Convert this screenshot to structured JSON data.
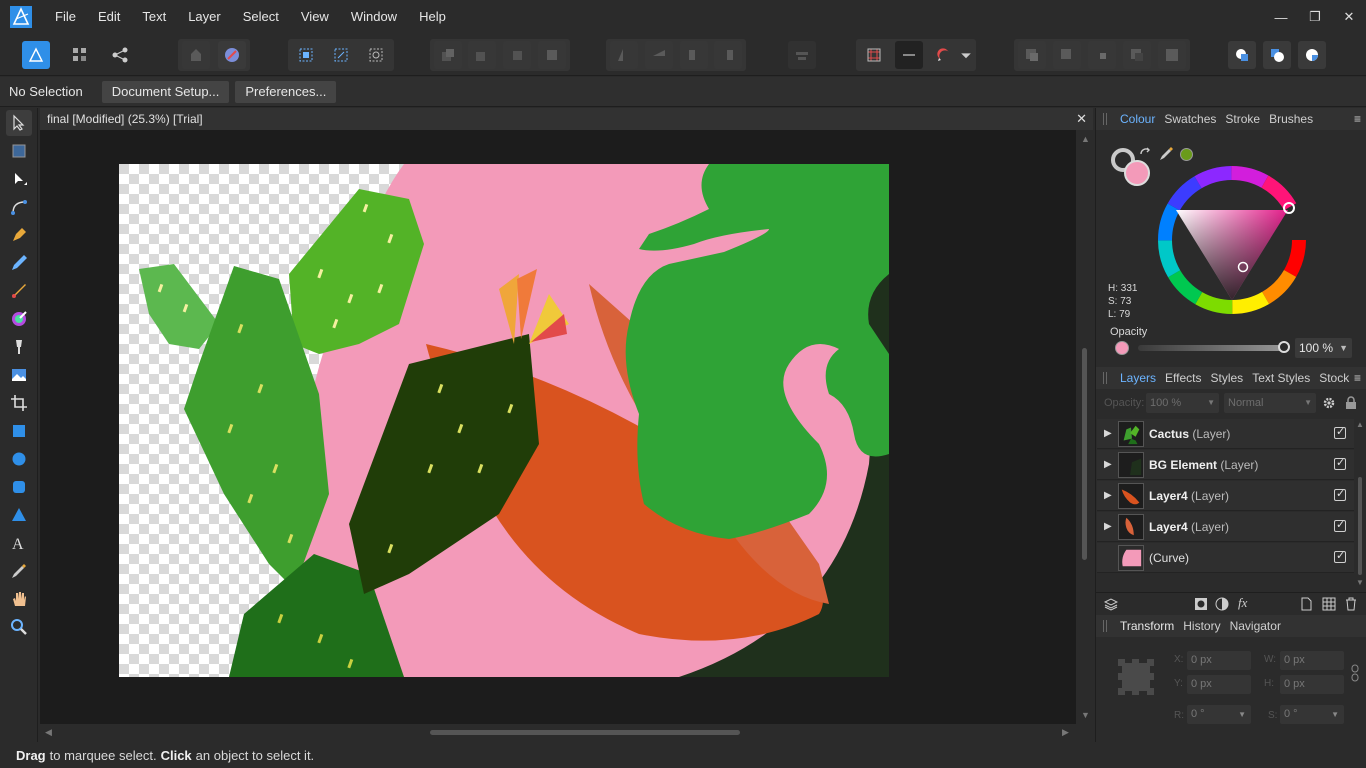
{
  "menubar": {
    "items": [
      "File",
      "Edit",
      "Text",
      "Layer",
      "Select",
      "View",
      "Window",
      "Help"
    ],
    "window_controls": [
      "minimize",
      "restore",
      "close"
    ]
  },
  "context": {
    "selection_label": "No Selection",
    "document_setup": "Document Setup...",
    "preferences": "Preferences..."
  },
  "document": {
    "tab_title": "final [Modified] (25.3%) [Trial]"
  },
  "colour_panel": {
    "tabs": [
      "Colour",
      "Swatches",
      "Stroke",
      "Brushes"
    ],
    "active_tab": "Colour",
    "h": "H: 331",
    "s": "S: 73",
    "l": "L: 79",
    "opacity_label": "Opacity",
    "opacity_value": "100 %",
    "current_colour": "#f39ab9"
  },
  "layers_panel": {
    "tabs": [
      "Layers",
      "Effects",
      "Styles",
      "Text Styles",
      "Stock"
    ],
    "active_tab": "Layers",
    "opacity_label": "Opacity:",
    "opacity_value": "100 %",
    "blend_mode": "Normal",
    "layers": [
      {
        "name": "Cactus",
        "type": "(Layer)",
        "expandable": true,
        "visible": true
      },
      {
        "name": "BG Element",
        "type": "(Layer)",
        "expandable": true,
        "visible": true
      },
      {
        "name": "Layer4",
        "type": "(Layer)",
        "expandable": true,
        "visible": true
      },
      {
        "name": "Layer4",
        "type": "(Layer)",
        "expandable": true,
        "visible": true
      },
      {
        "name": "",
        "type": "(Curve)",
        "expandable": false,
        "visible": true
      }
    ]
  },
  "transform_panel": {
    "tabs": [
      "Transform",
      "History",
      "Navigator"
    ],
    "active_tab": "Transform",
    "x_label": "X:",
    "x": "0 px",
    "y_label": "Y:",
    "y": "0 px",
    "w_label": "W:",
    "w": "0 px",
    "h_label": "H:",
    "h": "0 px",
    "r_label": "R:",
    "r": "0 °",
    "s_label": "S:",
    "s": "0 °"
  },
  "status": {
    "drag": "Drag",
    "drag_text": "to marquee select.",
    "click": "Click",
    "click_text": "an object to select it."
  },
  "colors": {
    "accent": "#6cb4ff",
    "canvas_pink": "#f39ab9",
    "cactus_light": "#53b327",
    "cactus_mid": "#3e9e2e",
    "cactus_dark": "#203d08",
    "leaf_orange": "#d9531f",
    "monstera": "#2fa336",
    "shadow_dark": "#1f301c"
  }
}
